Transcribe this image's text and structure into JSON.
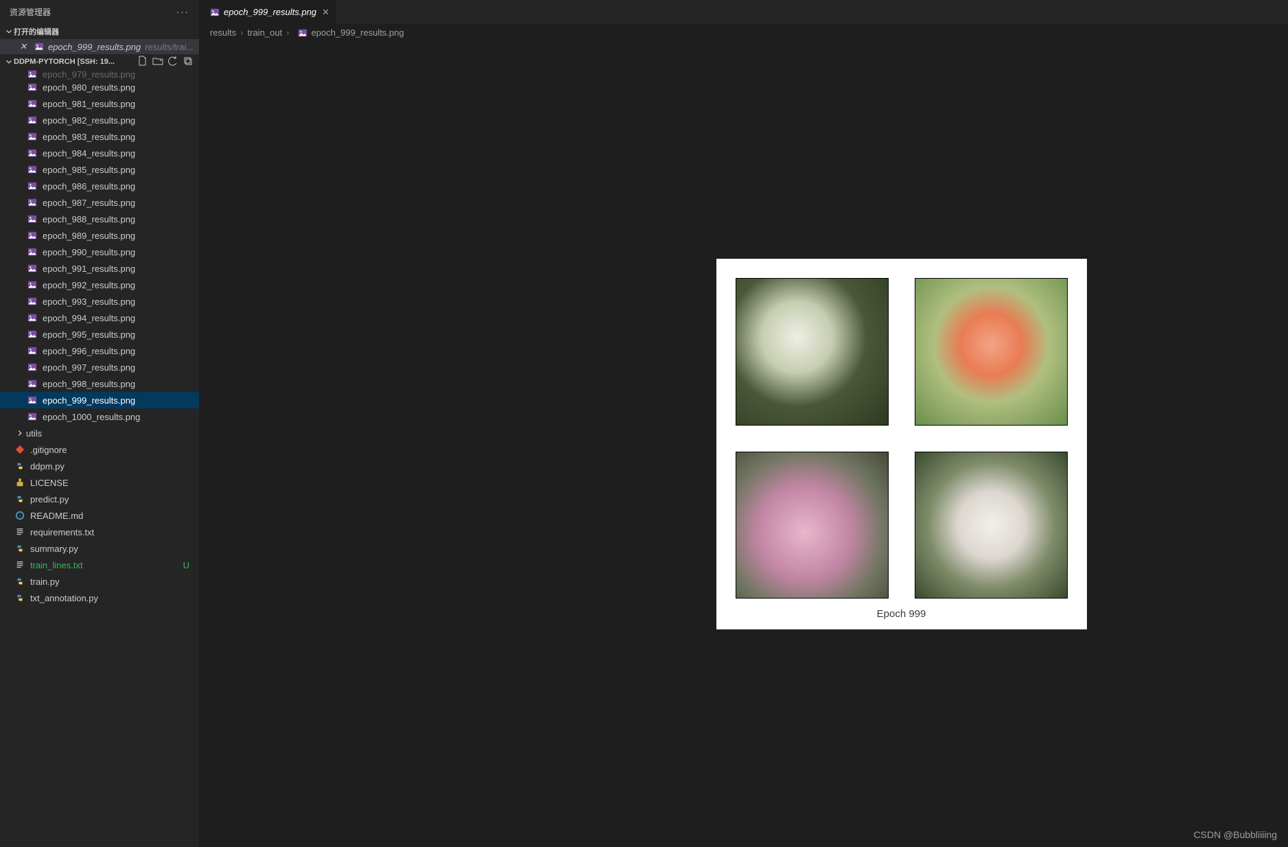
{
  "sidebar": {
    "title": "资源管理器",
    "openEditorsLabel": "打开的编辑器",
    "openEditor": {
      "filename": "epoch_999_results.png",
      "path": "results/trai..."
    },
    "projectTitle": "DDPM-PYTORCH [SSH: 19...",
    "treePartial": "epoch_979_results.png",
    "files": [
      "epoch_980_results.png",
      "epoch_981_results.png",
      "epoch_982_results.png",
      "epoch_983_results.png",
      "epoch_984_results.png",
      "epoch_985_results.png",
      "epoch_986_results.png",
      "epoch_987_results.png",
      "epoch_988_results.png",
      "epoch_989_results.png",
      "epoch_990_results.png",
      "epoch_991_results.png",
      "epoch_992_results.png",
      "epoch_993_results.png",
      "epoch_994_results.png",
      "epoch_995_results.png",
      "epoch_996_results.png",
      "epoch_997_results.png",
      "epoch_998_results.png"
    ],
    "selected": "epoch_999_results.png",
    "afterSelected": "epoch_1000_results.png",
    "folder": "utils",
    "rootFiles": [
      {
        "name": ".gitignore",
        "icon": "git"
      },
      {
        "name": "ddpm.py",
        "icon": "py"
      },
      {
        "name": "LICENSE",
        "icon": "lic"
      },
      {
        "name": "predict.py",
        "icon": "py"
      },
      {
        "name": "README.md",
        "icon": "md"
      },
      {
        "name": "requirements.txt",
        "icon": "txt"
      },
      {
        "name": "summary.py",
        "icon": "py"
      },
      {
        "name": "train_lines.txt",
        "icon": "txt",
        "green": true,
        "badge": "U"
      },
      {
        "name": "train.py",
        "icon": "py"
      },
      {
        "name": "txt_annotation.py",
        "icon": "py"
      }
    ]
  },
  "tab": {
    "filename": "epoch_999_results.png"
  },
  "breadcrumb": {
    "p0": "results",
    "p1": "train_out",
    "p2": "epoch_999_results.png"
  },
  "figure": {
    "caption": "Epoch 999"
  },
  "watermark": "CSDN @Bubbliiiing"
}
